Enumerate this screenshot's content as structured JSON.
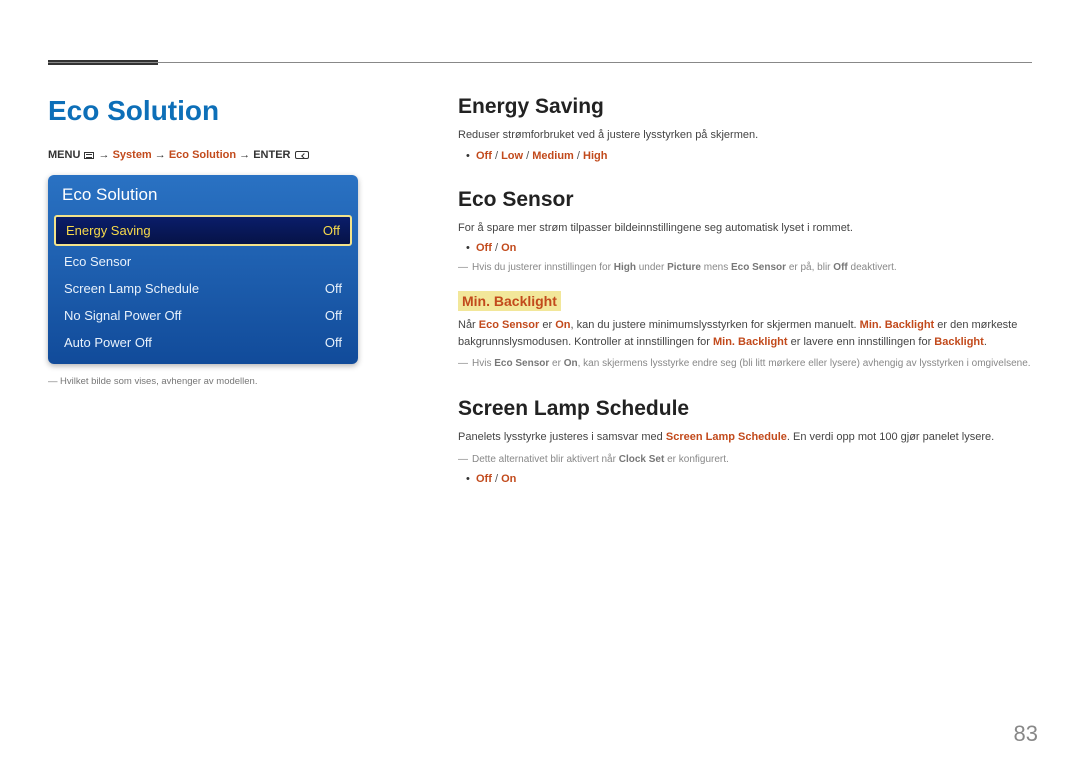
{
  "page_number": "83",
  "title": "Eco Solution",
  "breadcrumb": {
    "prefix": "MENU",
    "arrow": " → ",
    "system": "System",
    "eco": "Eco Solution",
    "enter": "ENTER"
  },
  "osd": {
    "title": "Eco Solution",
    "rows": [
      {
        "label": "Energy Saving",
        "value": "Off",
        "selected": true
      },
      {
        "label": "Eco Sensor",
        "value": "",
        "selected": false
      },
      {
        "label": "Screen Lamp Schedule",
        "value": "Off",
        "selected": false
      },
      {
        "label": "No Signal Power Off",
        "value": "Off",
        "selected": false
      },
      {
        "label": "Auto Power Off",
        "value": "Off",
        "selected": false
      }
    ]
  },
  "left_footnote": "Hvilket bilde som vises, avhenger av modellen.",
  "sections": {
    "energy_saving": {
      "heading": "Energy Saving",
      "desc": "Reduser strømforbruket ved å justere lysstyrken på skjermen.",
      "options": [
        "Off",
        "Low",
        "Medium",
        "High"
      ]
    },
    "eco_sensor": {
      "heading": "Eco Sensor",
      "desc": "For å spare mer strøm tilpasser bildeinnstillingene seg automatisk lyset i rommet.",
      "options": [
        "Off",
        "On"
      ],
      "note_pre": "Hvis du justerer innstillingen for ",
      "note_high": "High",
      "note_mid1": " under ",
      "note_picture": "Picture",
      "note_mid2": " mens ",
      "note_ecosensor": "Eco Sensor",
      "note_mid3": " er på, blir ",
      "note_off": "Off",
      "note_post": " deaktivert.",
      "sub_heading": "Min. Backlight",
      "sub_p1_a": "Når ",
      "sub_p1_b": "Eco Sensor",
      "sub_p1_c": " er ",
      "sub_p1_d": "On",
      "sub_p1_e": ", kan du justere minimumslysstyrken for skjermen manuelt. ",
      "sub_p1_f": "Min. Backlight",
      "sub_p1_g": " er den mørkeste bakgrunnslysmodusen. Kontroller at innstillingen for ",
      "sub_p1_h": "Min. Backlight",
      "sub_p1_i": " er lavere enn innstillingen for ",
      "sub_p1_j": "Backlight",
      "sub_p1_k": ".",
      "note2_a": "Hvis ",
      "note2_b": "Eco Sensor",
      "note2_c": " er ",
      "note2_d": "On",
      "note2_e": ", kan skjermens lysstyrke endre seg (bli litt mørkere eller lysere) avhengig av lysstyrken i omgivelsene."
    },
    "screen_lamp": {
      "heading": "Screen Lamp Schedule",
      "desc_a": "Panelets lysstyrke justeres i samsvar med ",
      "desc_b": "Screen Lamp Schedule",
      "desc_c": ". En verdi opp mot 100 gjør panelet lysere.",
      "note_a": "Dette alternativet blir aktivert når ",
      "note_b": "Clock Set",
      "note_c": " er konfigurert.",
      "options": [
        "Off",
        "On"
      ]
    }
  }
}
